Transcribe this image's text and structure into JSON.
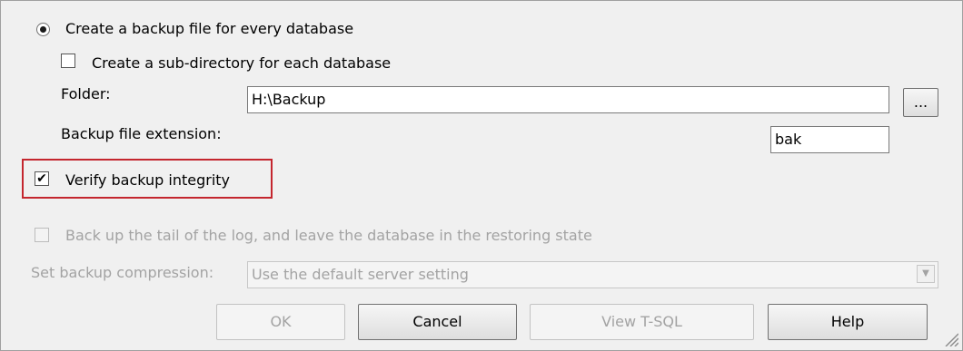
{
  "backup_options": {
    "create_per_database": {
      "label": "Create a backup file for every database",
      "selected": true
    },
    "sub_directory": {
      "label": "Create a sub-directory for each database",
      "checked": false
    },
    "folder": {
      "label": "Folder:",
      "value": "H:\\Backup",
      "browse_label": "..."
    },
    "extension": {
      "label": "Backup file extension:",
      "value": "bak"
    },
    "verify_integrity": {
      "label": "Verify backup integrity",
      "checked": true,
      "check_glyph": "✔"
    },
    "tail_log": {
      "label": "Back up the tail of the log, and leave the database in the restoring state",
      "checked": false,
      "enabled": false
    },
    "compression": {
      "label": "Set backup compression:",
      "value": "Use the default server setting",
      "arrow_glyph": "▼",
      "enabled": false
    }
  },
  "buttons": {
    "ok": {
      "label": "OK",
      "enabled": false
    },
    "cancel": {
      "label": "Cancel",
      "enabled": true
    },
    "view_tsql": {
      "label": "View T-SQL",
      "enabled": false
    },
    "help": {
      "label": "Help",
      "enabled": true
    }
  },
  "colors": {
    "highlight": "#c4262e",
    "background": "#f0f0f0",
    "disabled_text": "#a3a3a3"
  },
  "icons": {
    "radio_selected": "radio-button-icon",
    "checkbox": "checkbox-icon",
    "dropdown": "chevron-down-icon",
    "resize": "resize-grip-icon"
  }
}
